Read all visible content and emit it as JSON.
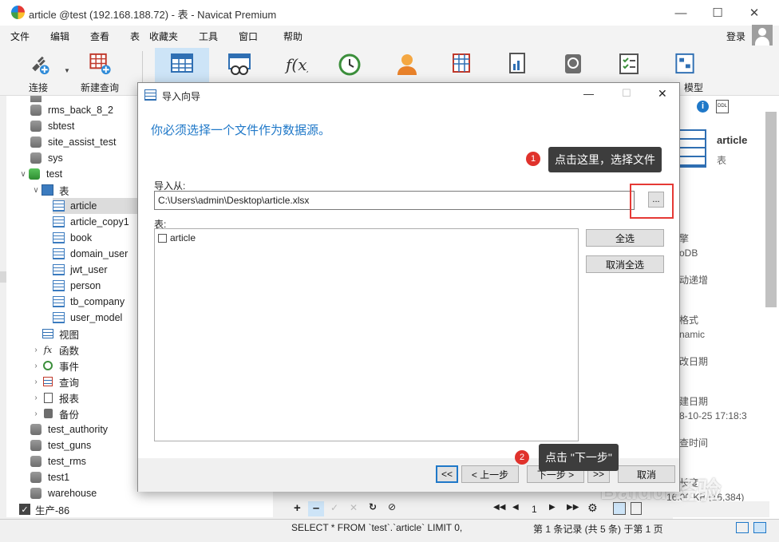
{
  "window": {
    "title": "article @test (192.168.188.72) - 表 - Navicat Premium"
  },
  "menu": {
    "items": [
      "文件",
      "编辑",
      "查看",
      "表",
      "收藏夹",
      "工具",
      "窗口",
      "帮助"
    ],
    "login": "登录"
  },
  "toolbar": {
    "connect": "连接",
    "new_query": "新建查询",
    "model": "模型"
  },
  "tree": {
    "items": [
      "rms_back_8_2",
      "sbtest",
      "site_assist_test",
      "sys",
      "test",
      "表",
      "article",
      "article_copy1",
      "book",
      "domain_user",
      "jwt_user",
      "person",
      "tb_company",
      "user_model",
      "视图",
      "函数",
      "事件",
      "查询",
      "报表",
      "备份",
      "test_authority",
      "test_guns",
      "test_rms",
      "test1",
      "warehouse",
      "生产-86"
    ]
  },
  "right_panel": {
    "name": "article",
    "sub": "表",
    "lines": [
      "擎",
      "oDB",
      "动递增",
      "格式",
      "namic",
      "改日期",
      "建日期",
      "8-10-25 17:18:3",
      "查时间",
      "长度",
      "16.00 KB (16,384)"
    ]
  },
  "dialog": {
    "title": "导入向导",
    "heading": "你必须选择一个文件作为数据源。",
    "import_from_label": "导入从:",
    "path_value": "C:\\Users\\admin\\Desktop\\article.xlsx",
    "browse_label": "...",
    "table_label": "表:",
    "tables": [
      "article"
    ],
    "select_all": "全选",
    "deselect_all": "取消全选",
    "first": "<<",
    "prev": "< 上一步",
    "next": "下一步 >",
    "last": ">>",
    "cancel": "取消"
  },
  "callouts": {
    "one_num": "1",
    "one_text": "点击这里，选择文件",
    "two_num": "2",
    "two_text": "点击 \"下一步\""
  },
  "bottom_tool": {
    "page": "1"
  },
  "status": {
    "sql": "SELECT * FROM `test`.`article` LIMIT 0,",
    "records": "第 1 条记录 (共 5 条) 于第 1 页"
  },
  "watermark": "Baidu 经验",
  "colors": {
    "accent": "#1f78c8",
    "callout_bg": "#3d3d3d",
    "badge": "#e0322c",
    "highlight_box": "#e53935"
  }
}
